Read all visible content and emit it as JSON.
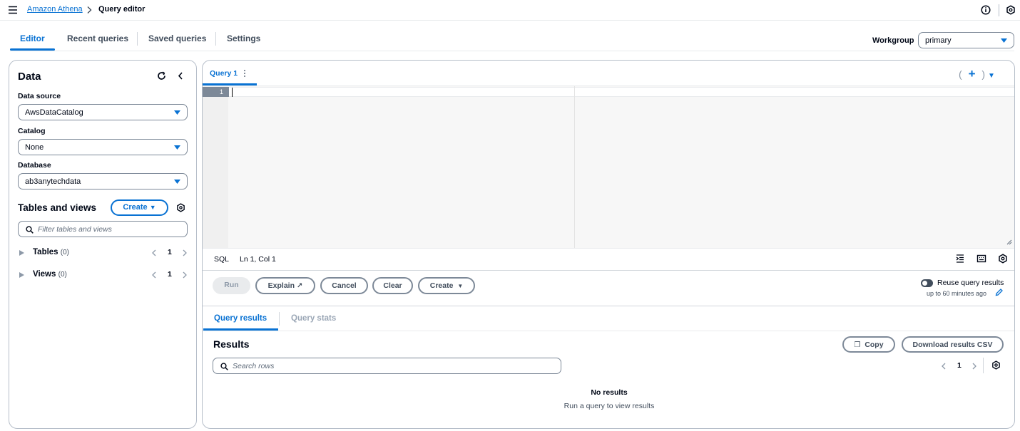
{
  "topbar": {
    "breadcrumb_parent": "Amazon Athena",
    "breadcrumb_current": "Query editor"
  },
  "tabs": [
    {
      "label": "Editor",
      "active": true
    },
    {
      "label": "Recent queries",
      "active": false
    },
    {
      "label": "Saved queries",
      "active": false
    },
    {
      "label": "Settings",
      "active": false
    }
  ],
  "workgroup": {
    "label": "Workgroup",
    "value": "primary"
  },
  "data_panel": {
    "title": "Data",
    "data_source": {
      "label": "Data source",
      "value": "AwsDataCatalog"
    },
    "catalog": {
      "label": "Catalog",
      "value": "None"
    },
    "database": {
      "label": "Database",
      "value": "ab3anytechdata"
    },
    "tables_views_title": "Tables and views",
    "create_label": "Create",
    "filter_placeholder": "Filter tables and views",
    "tree": [
      {
        "name": "Tables",
        "count": "(0)",
        "page": "1"
      },
      {
        "name": "Views",
        "count": "(0)",
        "page": "1"
      }
    ]
  },
  "editor": {
    "query_tab": "Query 1",
    "line_number": "1",
    "language": "SQL",
    "cursor_pos": "Ln 1, Col 1",
    "actions": {
      "run": "Run",
      "explain": "Explain",
      "cancel": "Cancel",
      "clear": "Clear",
      "create": "Create"
    },
    "reuse_label": "Reuse query results",
    "reuse_sub": "up to 60 minutes ago"
  },
  "results": {
    "tabs": [
      "Query results",
      "Query stats"
    ],
    "title": "Results",
    "copy": "Copy",
    "download": "Download results CSV",
    "search_placeholder": "Search rows",
    "page": "1",
    "empty_title": "No results",
    "empty_sub": "Run a query to view results"
  },
  "colors": {
    "accent": "#0972d3",
    "text": "#000716",
    "border": "#b6bec9"
  }
}
